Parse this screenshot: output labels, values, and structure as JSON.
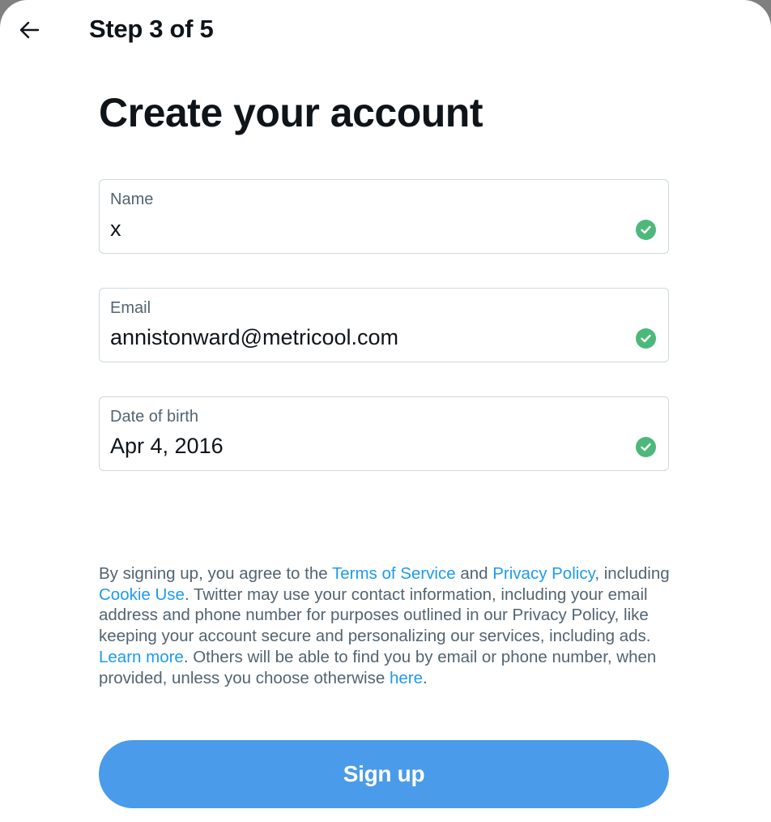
{
  "header": {
    "back_icon": "arrow-left-icon",
    "step_label": "Step 3 of 5"
  },
  "main": {
    "title": "Create your account",
    "fields": [
      {
        "label": "Name",
        "value": "x",
        "valid": true,
        "status_icon": "check-circle-icon"
      },
      {
        "label": "Email",
        "value": "annistonward@metricool.com",
        "valid": true,
        "status_icon": "check-circle-icon"
      },
      {
        "label": "Date of birth",
        "value": "Apr 4, 2016",
        "valid": true,
        "status_icon": "check-circle-icon"
      }
    ],
    "legal": {
      "t1": "By signing up, you agree to the ",
      "terms_link": "Terms of Service",
      "t2": " and ",
      "privacy_link": "Privacy Policy",
      "t3": ", including ",
      "cookie_link": "Cookie Use",
      "t4": ". Twitter may use your contact information, including your email address and phone number for purposes outlined in our Privacy Policy, like keeping your account secure and personalizing our services, including ads. ",
      "learn_more_link": "Learn more",
      "t5": ". Others will be able to find you by email or phone number, when provided, unless you choose otherwise ",
      "here_link": "here",
      "t6": "."
    },
    "signup_label": "Sign up"
  },
  "colors": {
    "accent": "#1d9bf0",
    "button": "#4a9be9",
    "valid": "#4cb97a",
    "text": "#0f1419",
    "muted": "#536471"
  }
}
